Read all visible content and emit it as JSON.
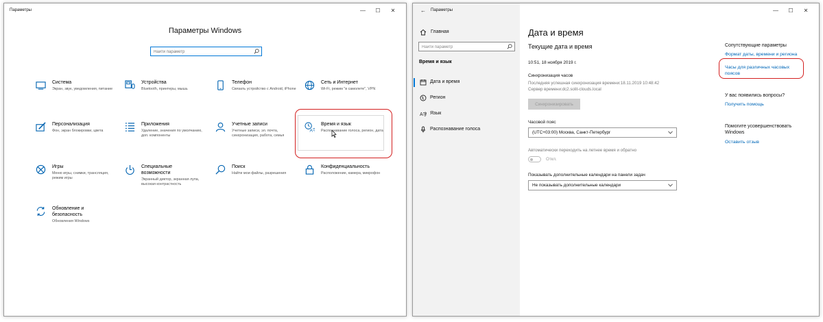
{
  "win1": {
    "title": "Параметры",
    "controls": {
      "minimize": "—",
      "maximize": "☐",
      "close": "✕"
    },
    "heading": "Параметры Windows",
    "search_placeholder": "Найти параметр",
    "tiles": [
      {
        "name": "Система",
        "desc": "Экран, звук, уведомления, питание",
        "icon": "monitor-icon"
      },
      {
        "name": "Устройства",
        "desc": "Bluetooth, принтеры, мышь",
        "icon": "devices-icon"
      },
      {
        "name": "Телефон",
        "desc": "Связать устройство с Android, iPhone",
        "icon": "phone-icon"
      },
      {
        "name": "Сеть и Интернет",
        "desc": "Wi-Fi, режим \"в самолете\", VPN",
        "icon": "globe-icon"
      },
      {
        "name": "Персонализация",
        "desc": "Фон, экран блокировки, цвета",
        "icon": "personalization-icon"
      },
      {
        "name": "Приложения",
        "desc": "Удаление, значения по умолчанию, доп. компоненты",
        "icon": "apps-icon"
      },
      {
        "name": "Учетные записи",
        "desc": "Учетные записи, эл. почта, синхронизация, работа, семья",
        "icon": "person-icon"
      },
      {
        "name": "Время и язык",
        "desc": "Распознавание голоса, регион, дата",
        "icon": "time-language-icon"
      },
      {
        "name": "Игры",
        "desc": "Меню игры, снимки, трансляция, режим игры",
        "icon": "xbox-icon"
      },
      {
        "name": "Специальные возможности",
        "desc": "Экранный диктор, экранная лупа, высокая контрастность",
        "icon": "accessibility-icon"
      },
      {
        "name": "Поиск",
        "desc": "Найти мои файлы, разрешения",
        "icon": "search-icon"
      },
      {
        "name": "Конфиденциальность",
        "desc": "Расположение, камера, микрофон",
        "icon": "lock-icon"
      },
      {
        "name": "Обновление и безопасность",
        "desc": "Обновления Windows",
        "icon": "update-icon"
      }
    ]
  },
  "win2": {
    "title": "Параметры",
    "back": "←",
    "controls": {
      "minimize": "—",
      "maximize": "☐",
      "close": "✕"
    },
    "home": "Главная",
    "search_placeholder": "Найти параметр",
    "section": "Время и язык",
    "nav": [
      {
        "label": "Дата и время",
        "icon": "calendar-icon",
        "active": true
      },
      {
        "label": "Регион",
        "icon": "region-icon",
        "active": false
      },
      {
        "label": "Язык",
        "icon": "language-icon",
        "active": false
      },
      {
        "label": "Распознавание голоса",
        "icon": "microphone-icon",
        "active": false
      }
    ],
    "main": {
      "title": "Дата и время",
      "subtitle": "Текущие дата и время",
      "current_time": "10:51, 18 ноября 2019 г.",
      "sync_label": "Синхронизация часов",
      "sync_last": "Последняя успешная синхронизация времени:18.11.2019 10:48:42",
      "sync_server": "Сервер времени:dc2.solit-clouds.local",
      "sync_button": "Синхронизировать",
      "tz_label": "Часовой пояс",
      "tz_value": "(UTC+03:00) Москва, Санкт-Петербург",
      "dst_label": "Автоматически переходить на летнее время и обратно",
      "dst_state": "Откл.",
      "cal_label": "Показывать дополнительные календари на панели задач",
      "cal_value": "Не показывать дополнительные календари"
    },
    "related": {
      "heading": "Сопутствующие параметры",
      "link_format": "Формат даты, времени и региона",
      "link_clocks": "Часы для различных часовых поясов",
      "questions": "У вас появились вопросы?",
      "help": "Получить помощь",
      "improve": "Помогите усовершенствовать Windows",
      "feedback": "Оставить отзыв"
    }
  },
  "colors": {
    "accent": "#0078d7",
    "link": "#0067b8",
    "highlight": "#d31f1f",
    "sidebar": "#f2f2f2"
  }
}
